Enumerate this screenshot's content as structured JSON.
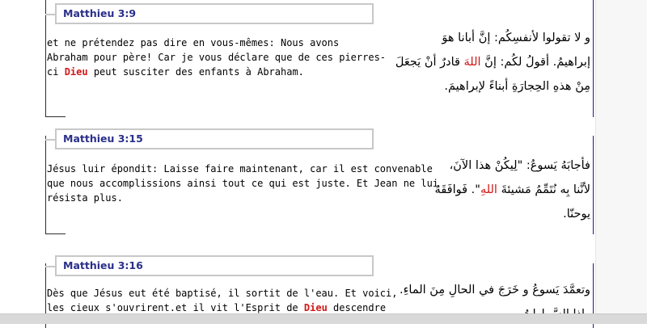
{
  "entries": [
    {
      "ref": "Matthieu 3:9",
      "fr_lines": [
        "et ne prétendez pas dire en vous-mêmes: Nous avons",
        "Abraham pour père! Car je vous déclare que de ces pierres-",
        {
          "pre": "ci ",
          "god": "Dieu",
          "post": " peut susciter des enfants à Abraham."
        }
      ],
      "ar_lines": [
        "و لا تقولوا لأنفسِكُم: إنَّ أبانا هوَ",
        {
          "pre": "إبراهيمُ. أقولُ لكُم: إنَّ ",
          "god": "اللهَ",
          "post": " قادرٌ أنْ يَجعَلَ"
        },
        "مِنْ هذهِ الحِجارَةِ أبناءً لإبراهيمَ."
      ]
    },
    {
      "ref": "Matthieu 3:15",
      "fr_lines": [
        "Jésus luir épondit: Laisse faire maintenant, car il est convenable",
        "que nous accomplissions ainsi tout ce qui est juste. Et Jean ne lui",
        "résista plus."
      ],
      "ar_lines": [
        "فأجابَهُ يَسوعُ: \"لِيكُنْ هذا الآنَ،",
        {
          "pre": "لأنَّنا بِه نُتَمِّمُ مَشيئةَ ",
          "god": "اللهِ",
          "post": "\". فَوافَقَهُ"
        },
        "يوحنّا."
      ]
    },
    {
      "ref": "Matthieu 3:16",
      "fr_lines": [
        "Dès que Jésus eut été baptisé, il sortit de l'eau. Et voici,",
        {
          "pre": "les cieux s'ouvrirent.et il vit l'Esprit de ",
          "god": "Dieu",
          "post": " descendre"
        }
      ],
      "ar_lines": [
        "وتعمَّدَ يَسوعُ و خَرَجَ في الحالِ مِنَ الماءِ.",
        "وإذا السَّماواتُ"
      ]
    }
  ]
}
